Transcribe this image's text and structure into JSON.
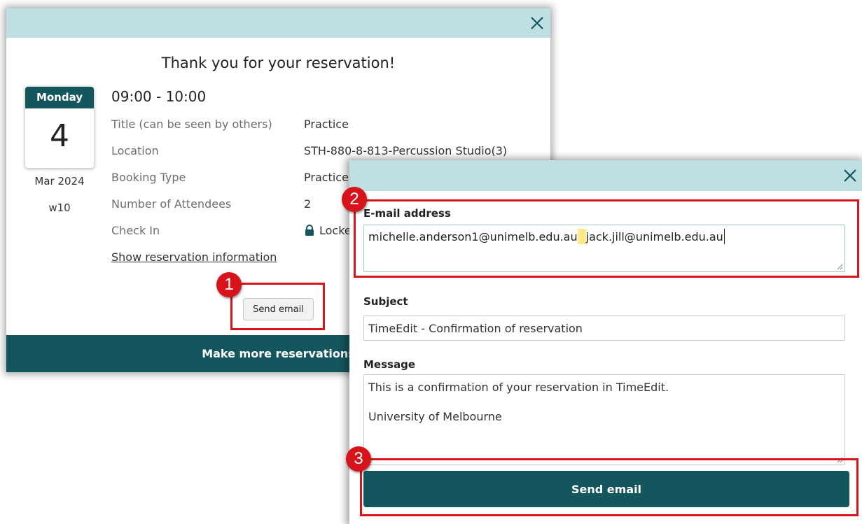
{
  "confirmation_dialog": {
    "heading": "Thank you for your reservation!",
    "date": {
      "weekday": "Monday",
      "day": "4",
      "month_year": "Mar 2024",
      "week": "w10"
    },
    "time_range": "09:00 - 10:00",
    "details": [
      {
        "label": "Title (can be seen by others)",
        "value": "Practice"
      },
      {
        "label": "Location",
        "value": "STH-880-8-813-Percussion Studio(3)"
      },
      {
        "label": "Booking Type",
        "value": "Practice"
      },
      {
        "label": "Number of Attendees",
        "value": "2"
      },
      {
        "label": "Check In",
        "value": "Locked"
      }
    ],
    "show_info_link": "Show reservation information",
    "send_email_button": "Send email",
    "make_more_button": "Make more reservations",
    "close_icon": "close-icon",
    "lock_icon": "lock-icon"
  },
  "email_dialog": {
    "email_label": "E-mail address",
    "email_value_1": "michelle.anderson1@unimelb.edu.au",
    "email_value_2": "jack.jill@unimelb.edu.au",
    "subject_label": "Subject",
    "subject_value": "TimeEdit - Confirmation of reservation",
    "message_label": "Message",
    "message_line_1": "This is a confirmation of your reservation in TimeEdit.",
    "message_line_2": "University of Melbourne",
    "send_button": "Send email",
    "close_icon": "close-icon"
  },
  "annotations": {
    "step_1": "1",
    "step_2": "2",
    "step_3": "3",
    "highlight_color": "#d7141c"
  },
  "colors": {
    "header_bar": "#bee0e2",
    "primary": "#14565e",
    "highlight": "#ffe98a"
  }
}
